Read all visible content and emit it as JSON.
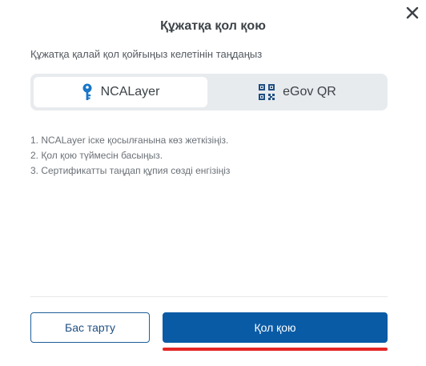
{
  "dialog": {
    "title": "Құжатқа қол қою",
    "subtitle": "Құжатқа қалай қол қойғыңыз келетінін таңдаңыз"
  },
  "methods": [
    {
      "label": "NCALayer",
      "icon": "key-icon",
      "selected": true
    },
    {
      "label": "eGov QR",
      "icon": "qr-code-icon",
      "selected": false
    }
  ],
  "steps": [
    "1. NCALayer іске қосылғанына көз жеткізіңіз.",
    "2. Қол қою түймесін басыңыз.",
    "3. Сертификатты таңдап құпия сөзді енгізіңіз"
  ],
  "buttons": {
    "cancel": "Бас тарту",
    "sign": "Қол қою"
  },
  "colors": {
    "primary": "#0a5ba6",
    "key_icon": "#1976c9",
    "qr_icon": "#1f4f82",
    "highlight": "#e52525",
    "toggle_bg": "#e8ebee"
  }
}
